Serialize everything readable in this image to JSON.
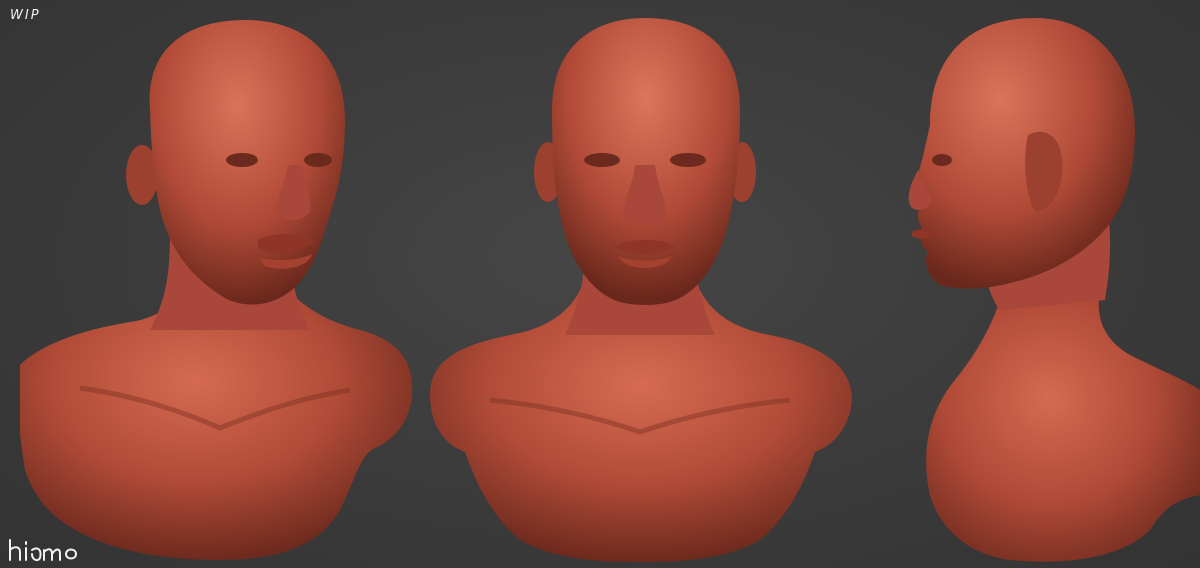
{
  "label": "WIP",
  "signature_text": "hiamo",
  "colors": {
    "background": "#3b3b3b",
    "skin_base": "#b9503c",
    "skin_highlight": "#d96a52",
    "skin_shadow": "#6e2a1e"
  },
  "views": [
    "three-quarter",
    "front",
    "profile"
  ]
}
